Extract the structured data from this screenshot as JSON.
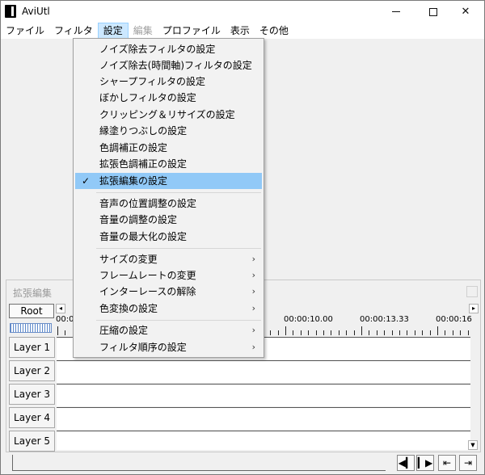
{
  "window": {
    "title": "AviUtl",
    "min_glyph": "",
    "max_glyph": "",
    "close_glyph": "✕"
  },
  "menubar": {
    "items": [
      {
        "label": "ファイル",
        "state": "normal"
      },
      {
        "label": "フィルタ",
        "state": "normal"
      },
      {
        "label": "設定",
        "state": "active"
      },
      {
        "label": "編集",
        "state": "disabled"
      },
      {
        "label": "プロファイル",
        "state": "normal"
      },
      {
        "label": "表示",
        "state": "normal"
      },
      {
        "label": "その他",
        "state": "normal"
      }
    ]
  },
  "settings_menu": {
    "group1": [
      {
        "label": "ノイズ除去フィルタの設定"
      },
      {
        "label": "ノイズ除去(時間軸)フィルタの設定"
      },
      {
        "label": "シャープフィルタの設定"
      },
      {
        "label": "ぼかしフィルタの設定"
      },
      {
        "label": "クリッピング＆リサイズの設定"
      },
      {
        "label": "縁塗りつぶしの設定"
      },
      {
        "label": "色調補正の設定"
      },
      {
        "label": "拡張色調補正の設定"
      },
      {
        "label": "拡張編集の設定",
        "checked": true,
        "check_glyph": "✓"
      }
    ],
    "group2": [
      {
        "label": "音声の位置調整の設定"
      },
      {
        "label": "音量の調整の設定"
      },
      {
        "label": "音量の最大化の設定"
      }
    ],
    "group3": [
      {
        "label": "サイズの変更",
        "arrow": "›"
      },
      {
        "label": "フレームレートの変更",
        "arrow": "›"
      },
      {
        "label": "インターレースの解除",
        "arrow": "›"
      },
      {
        "label": "色変換の設定",
        "arrow": "›"
      }
    ],
    "group4": [
      {
        "label": "圧縮の設定",
        "arrow": "›"
      },
      {
        "label": "フィルタ順序の設定",
        "arrow": "›"
      }
    ]
  },
  "timeline": {
    "title": "拡張編集",
    "root_label": "Root",
    "scroll_left_glyph": "◂",
    "scroll_right_glyph": "▸",
    "time_labels": [
      "00:00",
      "00:00:10.00",
      "00:00:13.33",
      "00:00:16"
    ],
    "layers": [
      "Layer 1",
      "Layer 2",
      "Layer 3",
      "Layer 4",
      "Layer 5"
    ]
  },
  "transport": {
    "prev_glyph": "◀▎",
    "next_glyph": "▎▶",
    "start_glyph": "⇤",
    "end_glyph": "⇥"
  }
}
